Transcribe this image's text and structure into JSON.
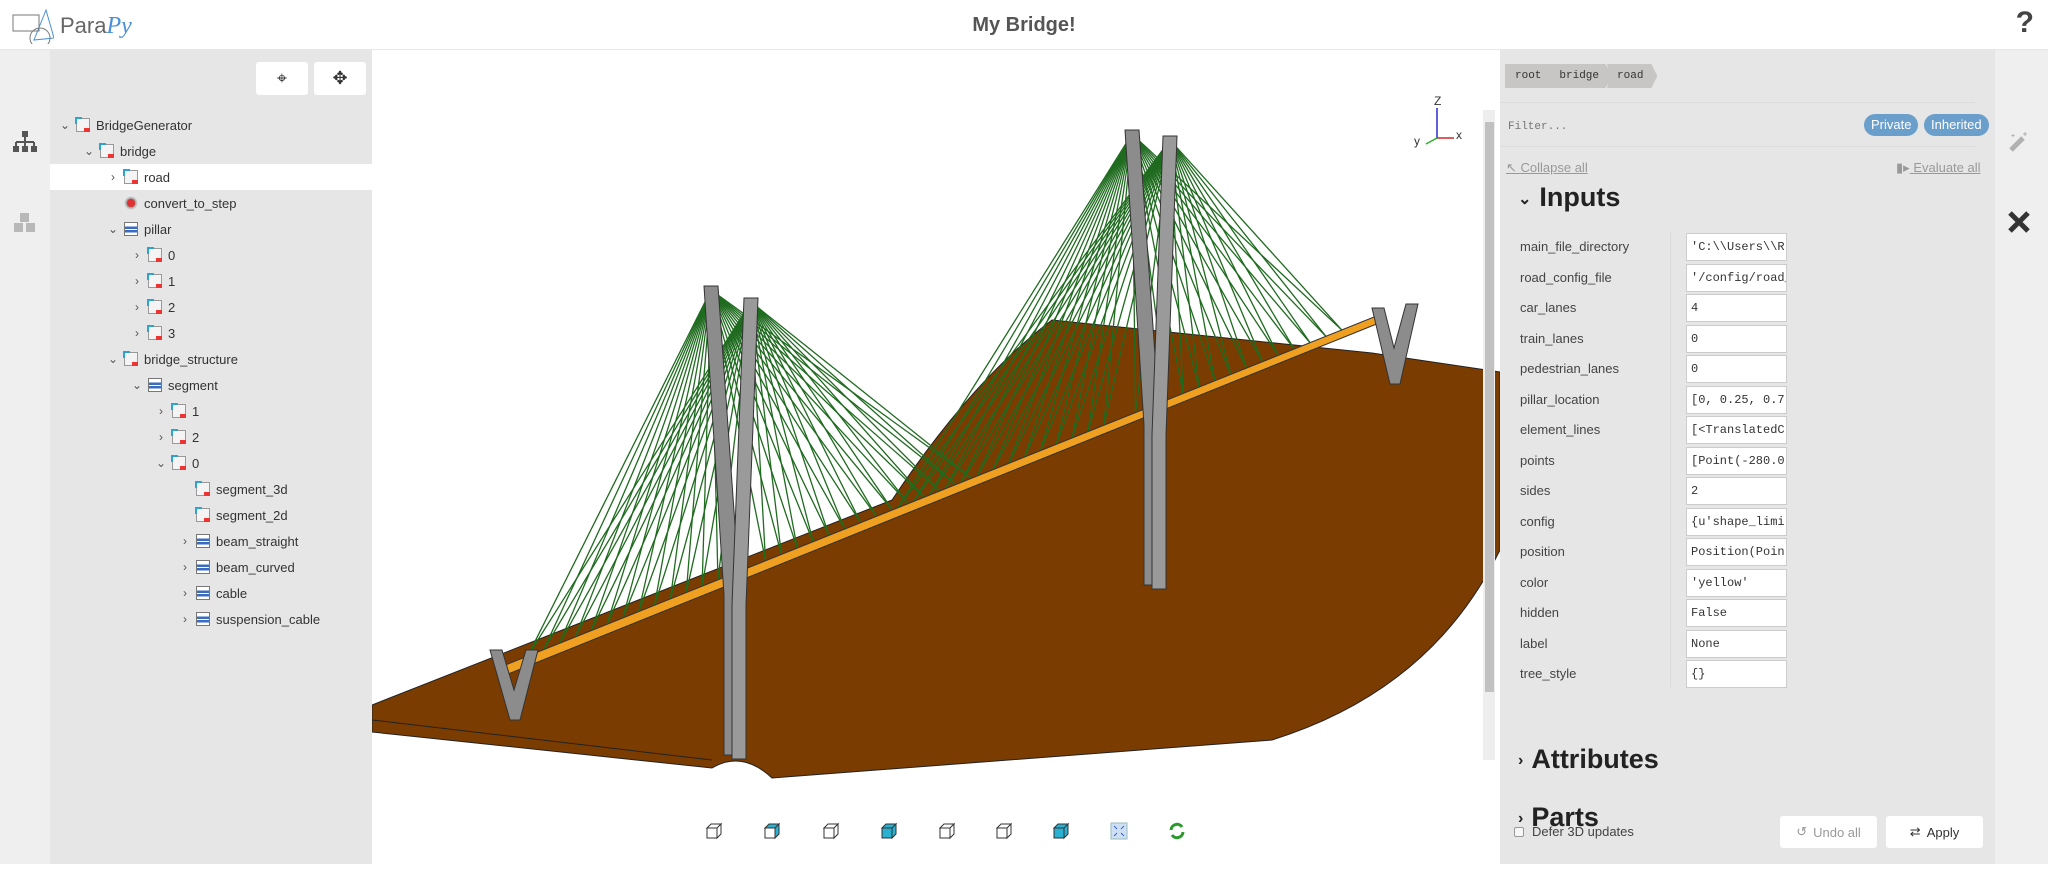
{
  "header": {
    "logo_text": "Para",
    "logo_text_italic": "Py",
    "title": "My Bridge!",
    "help": "?"
  },
  "tree": {
    "items": [
      {
        "label": "BridgeGenerator",
        "depth": 0,
        "chevron": "down",
        "icon": "obj"
      },
      {
        "label": "bridge",
        "depth": 1,
        "chevron": "down",
        "icon": "obj"
      },
      {
        "label": "road",
        "depth": 2,
        "chevron": "right",
        "icon": "obj",
        "selected": true
      },
      {
        "label": "convert_to_step",
        "depth": 2,
        "chevron": "",
        "icon": "act"
      },
      {
        "label": "pillar",
        "depth": 2,
        "chevron": "down",
        "icon": "seq"
      },
      {
        "label": "0",
        "depth": 3,
        "chevron": "right",
        "icon": "obj"
      },
      {
        "label": "1",
        "depth": 3,
        "chevron": "right",
        "icon": "obj"
      },
      {
        "label": "2",
        "depth": 3,
        "chevron": "right",
        "icon": "obj"
      },
      {
        "label": "3",
        "depth": 3,
        "chevron": "right",
        "icon": "obj"
      },
      {
        "label": "bridge_structure",
        "depth": 2,
        "chevron": "down",
        "icon": "obj"
      },
      {
        "label": "segment",
        "depth": 3,
        "chevron": "down",
        "icon": "seq"
      },
      {
        "label": "1",
        "depth": 4,
        "chevron": "right",
        "icon": "obj"
      },
      {
        "label": "2",
        "depth": 4,
        "chevron": "right",
        "icon": "obj"
      },
      {
        "label": "0",
        "depth": 4,
        "chevron": "down",
        "icon": "obj"
      },
      {
        "label": "segment_3d",
        "depth": 5,
        "chevron": "",
        "icon": "obj"
      },
      {
        "label": "segment_2d",
        "depth": 5,
        "chevron": "",
        "icon": "obj"
      },
      {
        "label": "beam_straight",
        "depth": 5,
        "chevron": "right",
        "icon": "seq"
      },
      {
        "label": "beam_curved",
        "depth": 5,
        "chevron": "right",
        "icon": "seq"
      },
      {
        "label": "cable",
        "depth": 5,
        "chevron": "right",
        "icon": "seq"
      },
      {
        "label": "suspension_cable",
        "depth": 5,
        "chevron": "right",
        "icon": "seq"
      }
    ]
  },
  "viewport": {
    "axes": {
      "z": "Z",
      "y": "y",
      "x": "x"
    },
    "toolbar": [
      "view-front",
      "view-top",
      "view-right",
      "view-back",
      "view-left",
      "view-bottom",
      "view-iso",
      "fit-all",
      "refresh"
    ]
  },
  "panel": {
    "breadcrumb": [
      "root",
      "bridge",
      "road"
    ],
    "filter_placeholder": "Filter...",
    "private": "Private",
    "inherited": "Inherited",
    "collapse_all": "↖ Collapse all",
    "evaluate_all": "Evaluate all",
    "inputs_title": "Inputs",
    "inputs": [
      {
        "name": "main_file_directory",
        "value": "'C:\\\\Users\\\\R"
      },
      {
        "name": "road_config_file",
        "value": "'/config/road_"
      },
      {
        "name": "car_lanes",
        "value": "4"
      },
      {
        "name": "train_lanes",
        "value": "0"
      },
      {
        "name": "pedestrian_lanes",
        "value": "0"
      },
      {
        "name": "pillar_location",
        "value": "[0, 0.25, 0.7"
      },
      {
        "name": "element_lines",
        "value": "[<TranslatedC"
      },
      {
        "name": "points",
        "value": "[Point(-280.0"
      },
      {
        "name": "sides",
        "value": "2"
      },
      {
        "name": "config",
        "value": "{u'shape_limi"
      },
      {
        "name": "position",
        "value": "Position(Poin"
      },
      {
        "name": "color",
        "value": "'yellow'"
      },
      {
        "name": "hidden",
        "value": "False"
      },
      {
        "name": "label",
        "value": "None"
      },
      {
        "name": "tree_style",
        "value": "{}"
      }
    ],
    "attributes_title": "Attributes",
    "parts_title": "Parts",
    "defer_label": "Defer 3D updates",
    "undo_label": "Undo all",
    "apply_label": "Apply"
  },
  "colors": {
    "ground": "#7a3c00",
    "deck": "#f0a020",
    "cable": "#1f6b1f",
    "pillar": "#8c8c8c",
    "accent": "#6b9fcb"
  }
}
